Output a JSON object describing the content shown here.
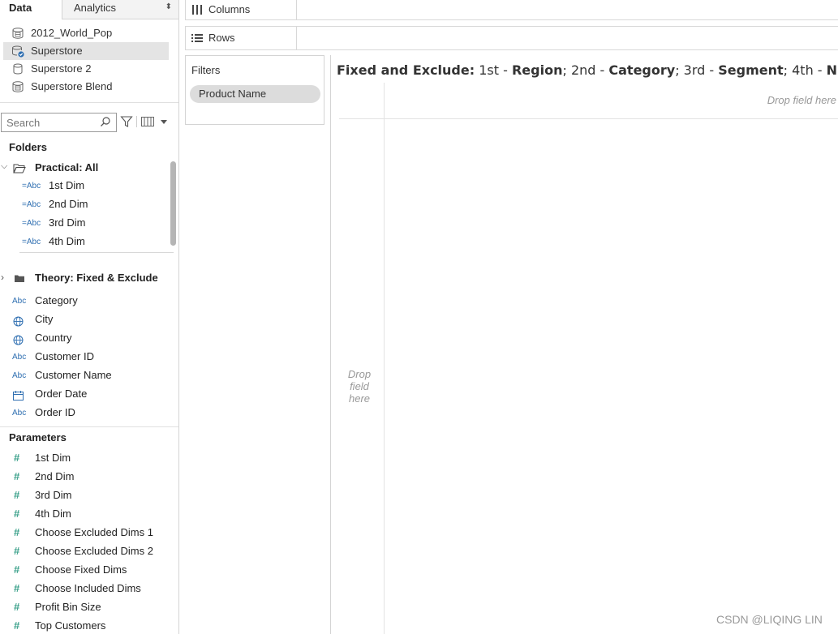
{
  "tabs": {
    "data": "Data",
    "analytics": "Analytics"
  },
  "datasources": [
    {
      "name": "2012_World_Pop",
      "icon": "multi-table-icon"
    },
    {
      "name": "Superstore",
      "icon": "connected-datasource-icon"
    },
    {
      "name": "Superstore 2",
      "icon": "database-icon"
    },
    {
      "name": "Superstore Blend",
      "icon": "multi-table-icon"
    }
  ],
  "search": {
    "placeholder": "Search"
  },
  "folders_heading": "Folders",
  "practical_folder": {
    "label": "Practical: All",
    "fields": [
      "1st Dim",
      "2nd Dim",
      "3rd Dim",
      "4th Dim"
    ],
    "icon_text": "=Abc"
  },
  "theory_folder": {
    "label": "Theory: Fixed & Exclude"
  },
  "dimensions": [
    {
      "label": "Category",
      "icon": "abc-icon",
      "icon_text": "Abc"
    },
    {
      "label": "City",
      "icon": "globe-icon"
    },
    {
      "label": "Country",
      "icon": "globe-icon"
    },
    {
      "label": "Customer ID",
      "icon": "abc-icon",
      "icon_text": "Abc"
    },
    {
      "label": "Customer Name",
      "icon": "abc-icon",
      "icon_text": "Abc"
    },
    {
      "label": "Order Date",
      "icon": "calendar-icon"
    },
    {
      "label": "Order ID",
      "icon": "abc-icon",
      "icon_text": "Abc"
    }
  ],
  "parameters_heading": "Parameters",
  "parameters": [
    "1st Dim",
    "2nd Dim",
    "3rd Dim",
    "4th Dim",
    "Choose Excluded Dims 1",
    "Choose Excluded Dims 2",
    "Choose Fixed Dims",
    "Choose Included Dims",
    "Profit Bin Size",
    "Top Customers"
  ],
  "parameter_icon_text": "#",
  "shelves": {
    "columns": "Columns",
    "rows": "Rows"
  },
  "filters": {
    "title": "Filters",
    "pills": [
      "Product Name"
    ]
  },
  "view": {
    "title_prefix": "Fixed and Exclude:",
    "t1": " 1st - ",
    "b1": "Region",
    "t2": "; 2nd - ",
    "b2": "Category",
    "t3": "; 3rd - ",
    "b3": "Segment",
    "t4": "; 4th - ",
    "b4": "Null",
    "drop_columns": "Drop field here",
    "drop_rows_1": "Drop",
    "drop_rows_2": "field",
    "drop_rows_3": "here"
  },
  "watermark": "CSDN @LIQING LIN",
  "colors": {
    "abc_icon": "#2f6fb1",
    "param_icon": "#3aa08a",
    "selected_bg": "#e4e4e4",
    "pill_bg": "#dcdcdc"
  }
}
